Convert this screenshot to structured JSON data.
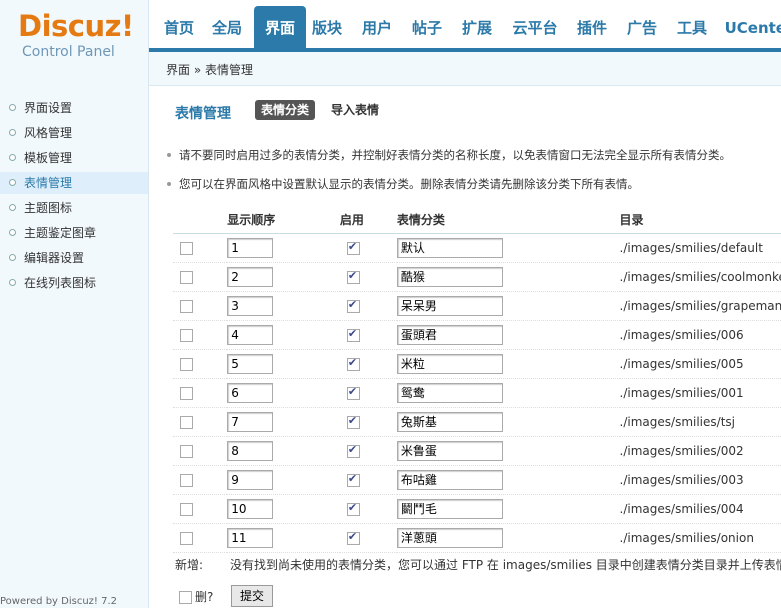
{
  "logo": {
    "brand": "Discuz",
    "bang": "!",
    "sub": "Control Panel"
  },
  "topnav": [
    {
      "label": "首页",
      "active": false
    },
    {
      "label": "全局",
      "active": false
    },
    {
      "label": "界面",
      "active": true
    },
    {
      "label": "版块",
      "active": false
    },
    {
      "label": "用户",
      "active": false
    },
    {
      "label": "帖子",
      "active": false
    },
    {
      "label": "扩展",
      "active": false
    },
    {
      "label": "云平台",
      "active": false
    },
    {
      "label": "插件",
      "active": false
    },
    {
      "label": "广告",
      "active": false
    },
    {
      "label": "工具",
      "active": false
    },
    {
      "label": "UCenter",
      "active": false
    }
  ],
  "breadcrumb": "界面 » 表情管理",
  "sidebar": {
    "items": [
      {
        "label": "界面设置",
        "active": false
      },
      {
        "label": "风格管理",
        "active": false
      },
      {
        "label": "模板管理",
        "active": false
      },
      {
        "label": "表情管理",
        "active": true
      },
      {
        "label": "主题图标",
        "active": false
      },
      {
        "label": "主题鉴定图章",
        "active": false
      },
      {
        "label": "编辑器设置",
        "active": false
      },
      {
        "label": "在线列表图标",
        "active": false
      }
    ],
    "powered": "Powered by Discuz! 7.2"
  },
  "main": {
    "title": "表情管理",
    "tab_active": "表情分类",
    "tab_other": "导入表情",
    "tips": [
      "请不要同时启用过多的表情分类，并控制好表情分类的名称长度，以免表情窗口无法完全显示所有表情分类。",
      "您可以在界面风格中设置默认显示的表情分类。删除表情分类请先删除该分类下所有表情。"
    ],
    "columns": {
      "order": "显示顺序",
      "enabled": "启用",
      "category": "表情分类",
      "dir": "目录"
    },
    "rows": [
      {
        "order": "1",
        "name": "默认",
        "dir": "./images/smilies/default"
      },
      {
        "order": "2",
        "name": "酷猴",
        "dir": "./images/smilies/coolmonkey"
      },
      {
        "order": "3",
        "name": "呆呆男",
        "dir": "./images/smilies/grapeman"
      },
      {
        "order": "4",
        "name": "蛋頭君",
        "dir": "./images/smilies/006"
      },
      {
        "order": "5",
        "name": "米粒",
        "dir": "./images/smilies/005"
      },
      {
        "order": "6",
        "name": "鸳鸯",
        "dir": "./images/smilies/001"
      },
      {
        "order": "7",
        "name": "兔斯基",
        "dir": "./images/smilies/tsj"
      },
      {
        "order": "8",
        "name": "米鲁蛋",
        "dir": "./images/smilies/002"
      },
      {
        "order": "9",
        "name": "布咕雞",
        "dir": "./images/smilies/003"
      },
      {
        "order": "10",
        "name": "鬭鬥毛",
        "dir": "./images/smilies/004"
      },
      {
        "order": "11",
        "name": "洋蔥頭",
        "dir": "./images/smilies/onion"
      }
    ],
    "new_label": "新增:",
    "new_msg": "没有找到尚未使用的表情分类，您可以通过 FTP 在 images/smilies 目录中创建表情分类目录并上传表情",
    "delete_label": "删?",
    "submit_label": "提交"
  }
}
